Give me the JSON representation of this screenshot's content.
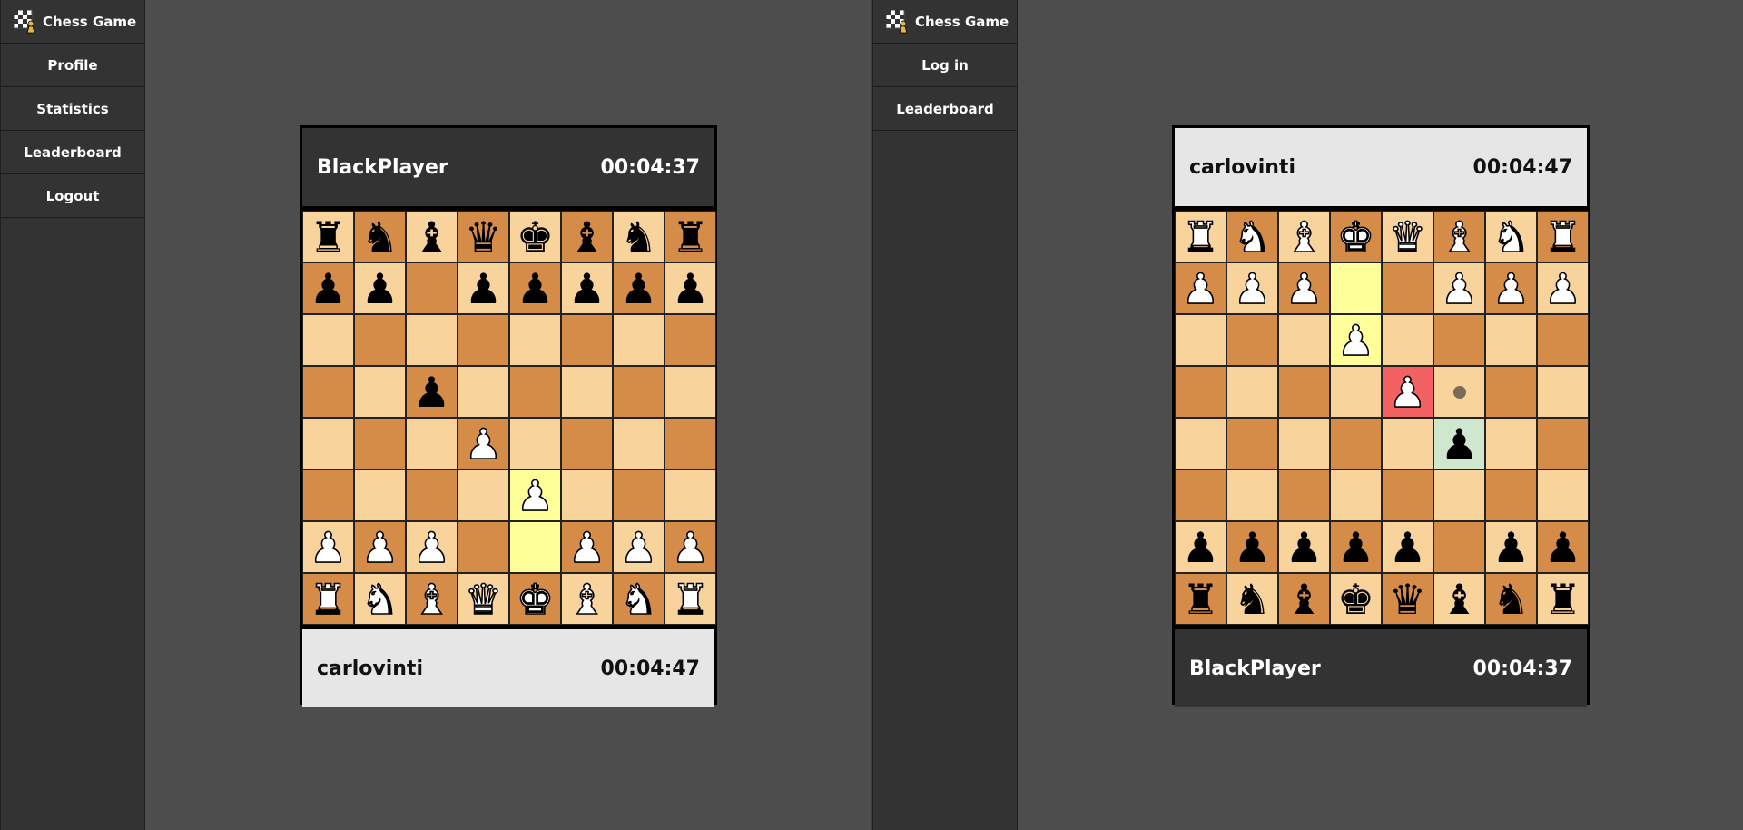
{
  "left": {
    "brand": "Chess Game",
    "nav": [
      "Profile",
      "Statistics",
      "Leaderboard",
      "Logout"
    ],
    "top_player": {
      "name": "BlackPlayer",
      "time": "00:04:37",
      "theme": "dark"
    },
    "bottom_player": {
      "name": "carlovinti",
      "time": "00:04:47",
      "theme": "light"
    },
    "board": [
      [
        "bR",
        "bN",
        "bB",
        "bQ",
        "bK",
        "bB",
        "bN",
        "bR"
      ],
      [
        "bP",
        "bP",
        "",
        "bP",
        "bP",
        "bP",
        "bP",
        "bP"
      ],
      [
        "",
        "",
        "",
        "",
        "",
        "",
        "",
        ""
      ],
      [
        "",
        "",
        "bP",
        "",
        "",
        "",
        "",
        ""
      ],
      [
        "",
        "",
        "",
        "wP",
        "",
        "",
        "",
        ""
      ],
      [
        "",
        "",
        "",
        "",
        "wP",
        "",
        "",
        ""
      ],
      [
        "wP",
        "wP",
        "wP",
        "",
        "",
        "wP",
        "wP",
        "wP"
      ],
      [
        "wR",
        "wN",
        "wB",
        "wQ",
        "wK",
        "wB",
        "wN",
        "wR"
      ]
    ],
    "highlights": [
      [
        5,
        4,
        "hl"
      ],
      [
        6,
        4,
        "hl"
      ]
    ],
    "dots": []
  },
  "right": {
    "brand": "Chess Game",
    "nav": [
      "Log in",
      "Leaderboard"
    ],
    "top_player": {
      "name": "carlovinti",
      "time": "00:04:47",
      "theme": "light"
    },
    "bottom_player": {
      "name": "BlackPlayer",
      "time": "00:04:37",
      "theme": "dark"
    },
    "board": [
      [
        "wR",
        "wN",
        "wB",
        "wK",
        "wQ",
        "wB",
        "wN",
        "wR"
      ],
      [
        "wP",
        "wP",
        "wP",
        "",
        "",
        "wP",
        "wP",
        "wP"
      ],
      [
        "",
        "",
        "",
        "wP",
        "",
        "",
        "",
        ""
      ],
      [
        "",
        "",
        "",
        "",
        "wP",
        "",
        "",
        ""
      ],
      [
        "",
        "",
        "",
        "",
        "",
        "bP",
        "",
        ""
      ],
      [
        "",
        "",
        "",
        "",
        "",
        "",
        "",
        ""
      ],
      [
        "bP",
        "bP",
        "bP",
        "bP",
        "bP",
        "",
        "bP",
        "bP"
      ],
      [
        "bR",
        "bN",
        "bB",
        "bK",
        "bQ",
        "bB",
        "bN",
        "bR"
      ]
    ],
    "highlights": [
      [
        1,
        3,
        "hl"
      ],
      [
        2,
        3,
        "hl"
      ],
      [
        3,
        4,
        "red"
      ],
      [
        4,
        5,
        "green"
      ]
    ],
    "dots": [
      [
        3,
        5
      ]
    ]
  },
  "colors": {
    "light_square": "#f9d39c",
    "dark_square": "#d48c48",
    "last_move": "#ffff99",
    "check": "#f26262",
    "selected": "#cfe6cf"
  }
}
